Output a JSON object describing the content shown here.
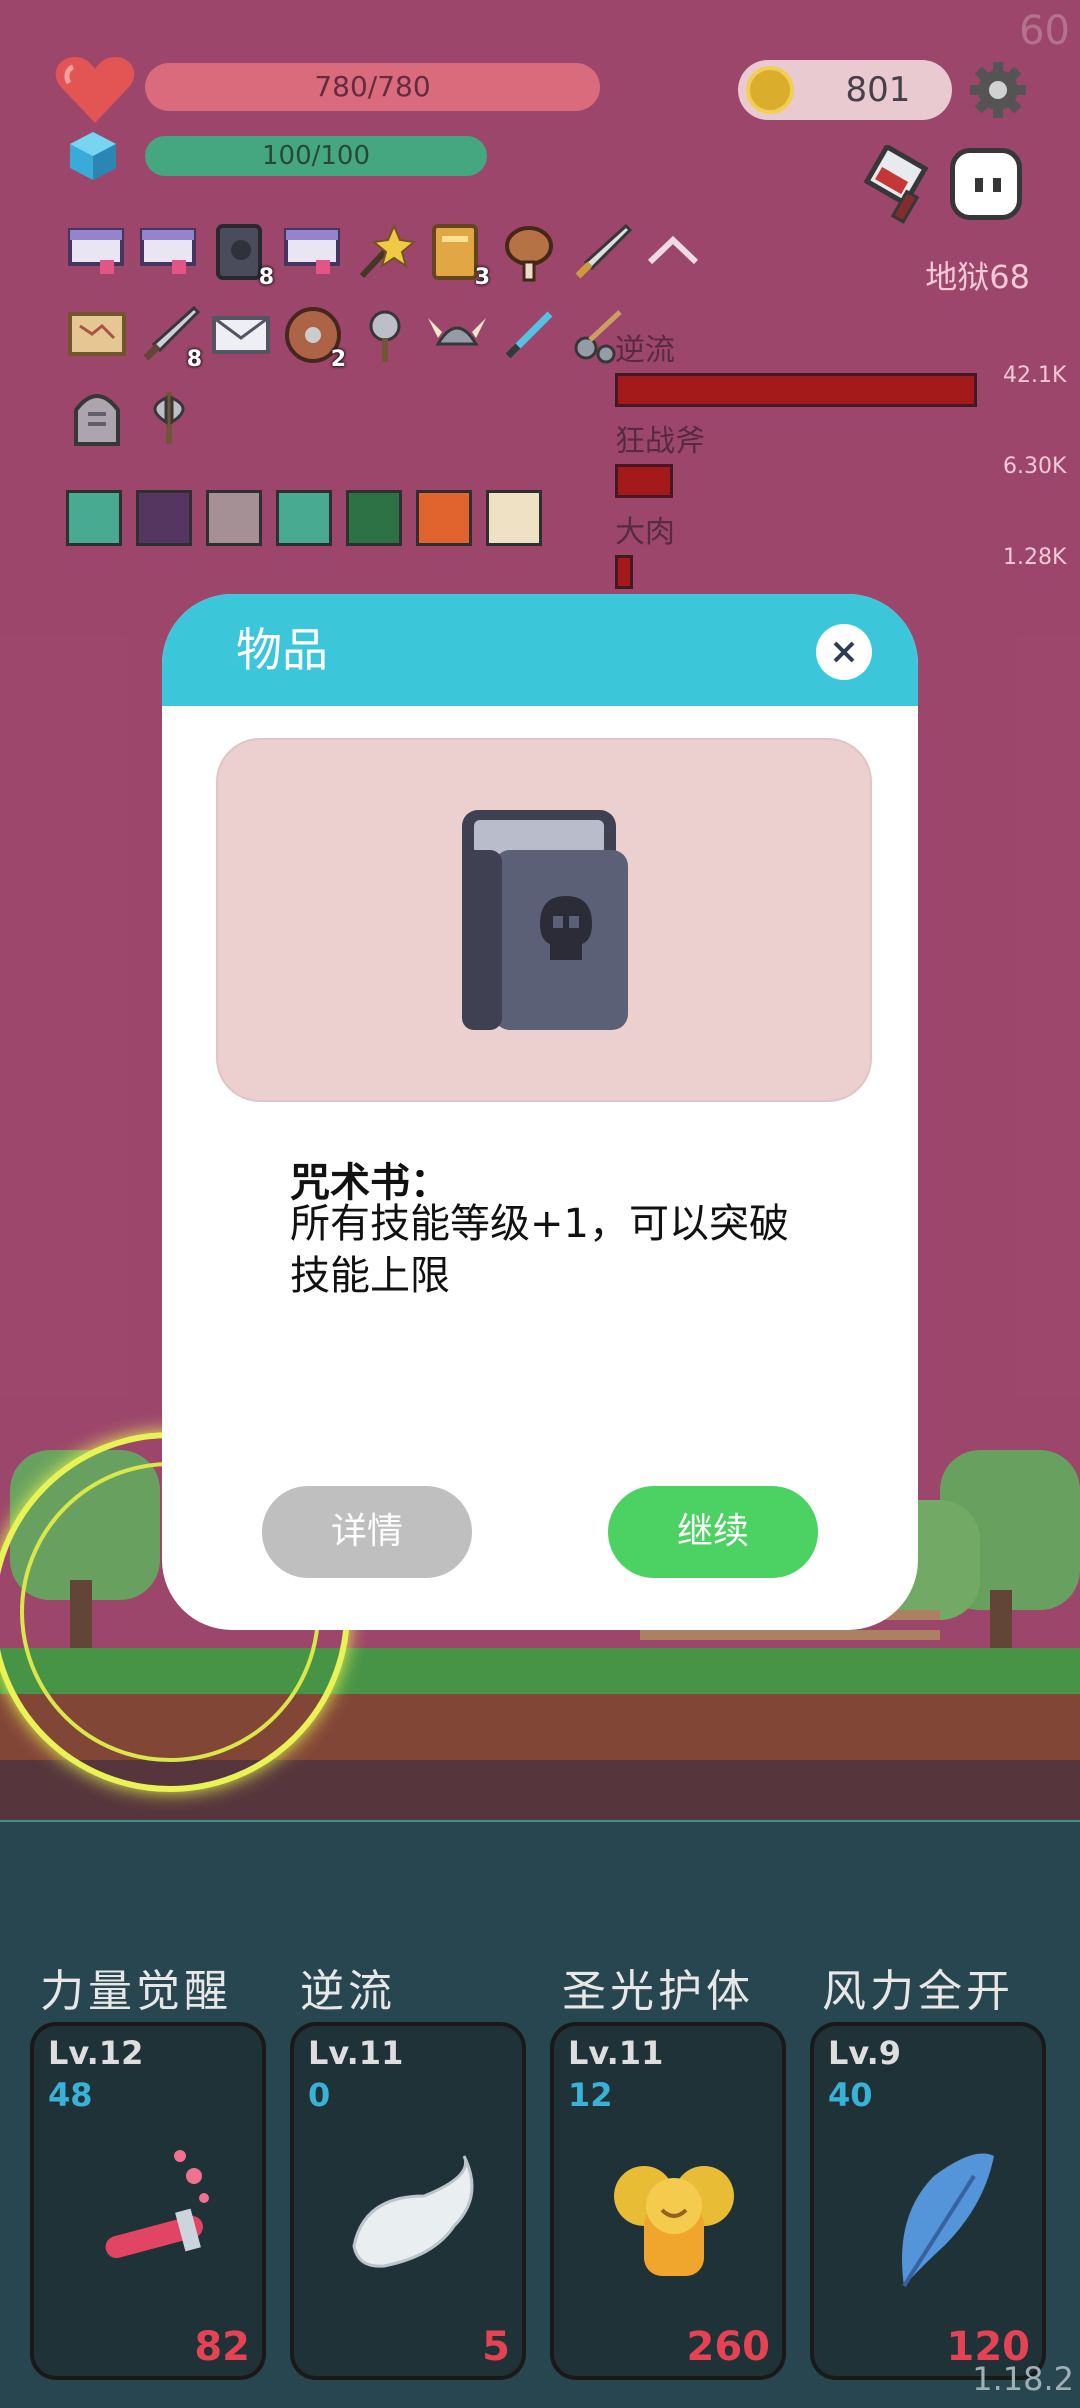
{
  "hud": {
    "fps": "60",
    "hp": "780/780",
    "mp": "100/100",
    "coins": "801",
    "stage": "地狱68"
  },
  "inventory": [
    {
      "icon": "scroll-icon",
      "count": ""
    },
    {
      "icon": "scroll-icon",
      "count": ""
    },
    {
      "icon": "skull-book-icon",
      "count": "8"
    },
    {
      "icon": "scroll-icon",
      "count": ""
    },
    {
      "icon": "magic-wand-icon",
      "count": ""
    },
    {
      "icon": "golden-book-icon",
      "count": "3"
    },
    {
      "icon": "meat-icon",
      "count": ""
    },
    {
      "icon": "sword-icon",
      "count": ""
    },
    {
      "icon": "chevron-up-icon",
      "count": ""
    },
    {
      "icon": "map-icon",
      "count": ""
    },
    {
      "icon": "sword-icon",
      "count": "8"
    },
    {
      "icon": "envelope-icon",
      "count": ""
    },
    {
      "icon": "shield-icon",
      "count": "2"
    },
    {
      "icon": "mace-icon",
      "count": ""
    },
    {
      "icon": "viking-helmet-icon",
      "count": ""
    },
    {
      "icon": "feather-sword-icon",
      "count": ""
    },
    {
      "icon": "flail-icon",
      "count": ""
    },
    {
      "icon": "gravestone-icon",
      "count": ""
    },
    {
      "icon": "battle-axe-icon",
      "count": ""
    }
  ],
  "buffs": [
    "light-buff-icon",
    "demon-buff-icon",
    "blade-buff-icon",
    "light-buff-icon",
    "poison-buff-icon",
    "fire-buff-icon",
    "burst-buff-icon"
  ],
  "damage": [
    {
      "label": "逆流",
      "value": "42.1K",
      "fraction": 1.0
    },
    {
      "label": "狂战斧",
      "value": "6.30K",
      "fraction": 0.15
    },
    {
      "label": "大肉",
      "value": "1.28K",
      "fraction": 0.03
    }
  ],
  "modal": {
    "title": "物品",
    "item_name": "咒术书：",
    "item_desc": "所有技能等级+1，可以突破技能上限",
    "detail_label": "详情",
    "continue_label": "继续"
  },
  "skills": [
    {
      "name": "力量觉醒",
      "lv": "Lv.12",
      "num": "48",
      "cost": "82",
      "icon": "potion-icon"
    },
    {
      "name": "逆流",
      "lv": "Lv.11",
      "num": "0",
      "cost": "5",
      "icon": "wing-icon"
    },
    {
      "name": "圣光护体",
      "lv": "Lv.11",
      "num": "12",
      "cost": "260",
      "icon": "golden-angel-icon"
    },
    {
      "name": "风力全开",
      "lv": "Lv.9",
      "num": "40",
      "cost": "120",
      "icon": "blue-feather-icon"
    }
  ],
  "version": "1.18.2",
  "colors": {
    "sky": "#963b62",
    "modal_header": "#3cc6da",
    "continue_button": "#4cd163",
    "detail_button": "#bfbfbf",
    "damage_bar": "#9f0b0b"
  }
}
